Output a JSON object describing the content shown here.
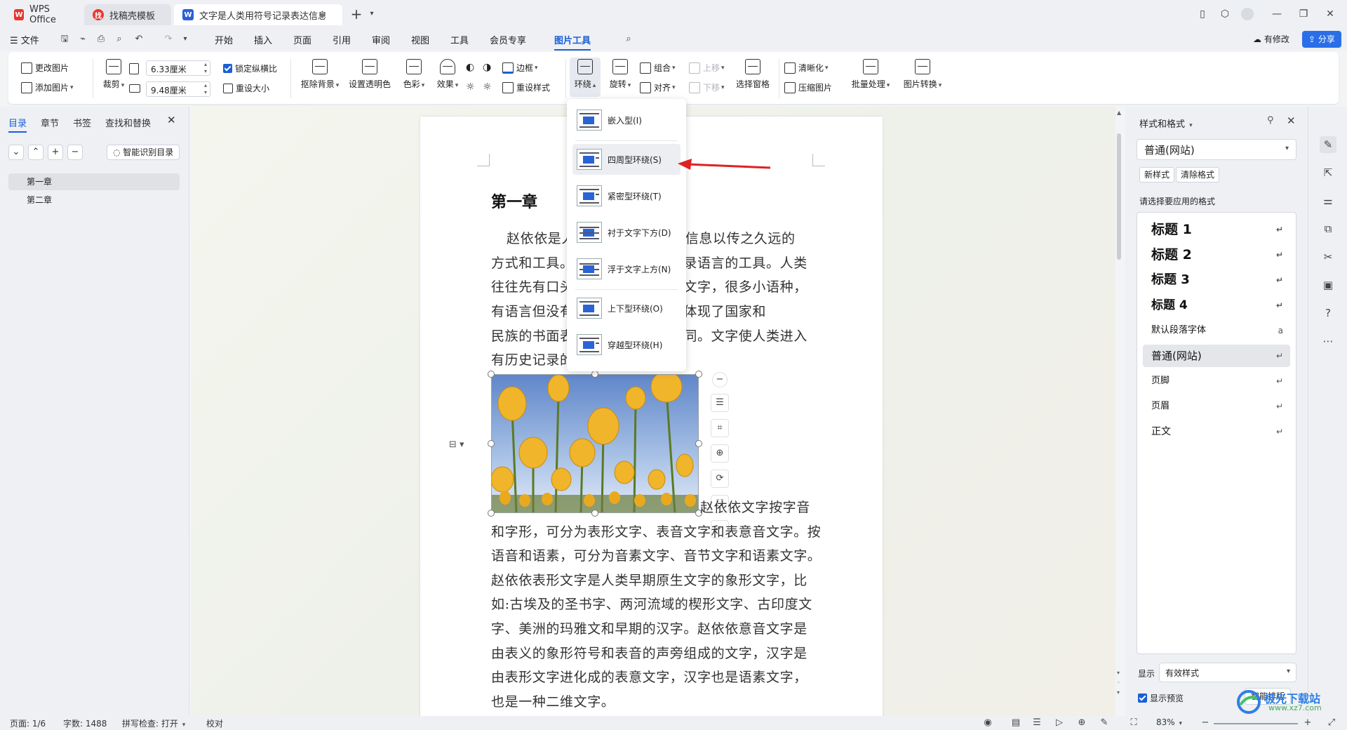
{
  "tabs": [
    {
      "label": "WPS Office",
      "icon": "wps-logo-icon"
    },
    {
      "label": "找稿壳模板",
      "icon": "template-icon"
    },
    {
      "label": "文字是人类用符号记录表达信息以…",
      "icon": "writer-doc-icon"
    }
  ],
  "menu": {
    "file": "文件",
    "items": [
      "开始",
      "插入",
      "页面",
      "引用",
      "审阅",
      "视图",
      "工具",
      "会员专享",
      "图片工具"
    ],
    "active": "图片工具",
    "modified": "有修改",
    "share": "分享"
  },
  "ribbon": {
    "change_pic": "更改图片",
    "add_pic": "添加图片",
    "crop": "裁剪",
    "width": "6.33厘米",
    "height": "9.48厘米",
    "lock_ratio": "锁定纵横比",
    "reset_size": "重设大小",
    "remove_bg": "抠除背景",
    "set_transparent": "设置透明色",
    "color": "色彩",
    "effect": "效果",
    "border": "边框",
    "reset_style": "重设样式",
    "wrap": "环绕",
    "rotate": "旋转",
    "group": "组合",
    "align": "对齐",
    "move_up": "上移",
    "move_down": "下移",
    "select_pane": "选择窗格",
    "sharpen": "清晰化",
    "compress": "压缩图片",
    "batch": "批量处理",
    "convert": "图片转换"
  },
  "wrap_menu": [
    {
      "label": "嵌入型(I)"
    },
    {
      "label": "四周型环绕(S)"
    },
    {
      "label": "紧密型环绕(T)"
    },
    {
      "label": "衬于文字下方(D)"
    },
    {
      "label": "浮于文字上方(N)"
    },
    {
      "label": "上下型环绕(O)"
    },
    {
      "label": "穿越型环绕(H)"
    }
  ],
  "leftpanel": {
    "tabs": [
      "目录",
      "章节",
      "书签",
      "查找和替换"
    ],
    "smart_toc": "智能识别目录",
    "toc": [
      "第一章",
      "第二章"
    ]
  },
  "document": {
    "heading": "第一章",
    "lines_top": [
      "赵依依是人类用符号记录表达信息以传之久远的",
      "方式和工具。现代文字大多是记录语言的工具。人类",
      "往往先有口头的语言后产生书面文字，很多小语种，",
      "有语言但没有文字。文字的不同体现了国家和",
      "民族的书面表达的方式和思维不同。文字使人类进入",
      "有历史记录的文明社会。"
    ],
    "lines_bottom": [
      "赵依依文字按字音",
      "和字形，可分为表形文字、表音文字和表意音文字。按",
      "语音和语素，可分为音素文字、音节文字和语素文字。",
      "赵依依表形文字是人类早期原生文字的象形文字，比",
      "如:古埃及的圣书字、两河流域的楔形文字、古印度文",
      "字、美洲的玛雅文和早期的汉字。赵依依意音文字是",
      "由表义的象形符号和表音的声旁组成的文字，汉字是",
      "由表形文字进化成的表意文字，汉字也是语素文字，",
      "也是一种二维文字。"
    ]
  },
  "rightpanel": {
    "title": "样式和格式",
    "current": "普通(网站)",
    "new_style": "新样式",
    "clear_format": "清除格式",
    "prompt": "请选择要应用的格式",
    "styles": [
      "标题 1",
      "标题 2",
      "标题 3",
      "标题 4",
      "默认段落字体",
      "普通(网站)",
      "页脚",
      "页眉",
      "正文"
    ],
    "show_label": "显示",
    "show_value": "有效样式",
    "preview": "显示预览",
    "smart_layout": "智能排版"
  },
  "status": {
    "page": "页面: 1/6",
    "words": "字数: 1488",
    "spell": "拼写检查: 打开",
    "proof": "校对",
    "zoom": "83%"
  },
  "watermark": "极光下载站",
  "watermark_url": "www.xz7.com"
}
